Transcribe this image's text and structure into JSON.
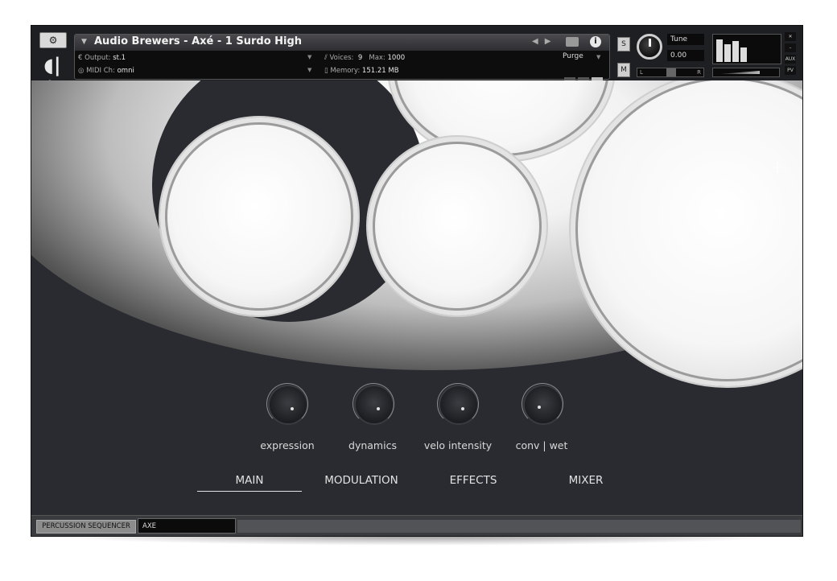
{
  "header": {
    "instrument_title": "Audio Brewers - Axé - 1 Surdo High",
    "output_label": "Output:",
    "output_value": "st.1",
    "voices_label": "Voices:",
    "voices_value": "9",
    "max_label": "Max:",
    "max_value": "1000",
    "midi_label": "MIDI Ch:",
    "midi_value": "omni",
    "memory_label": "Memory:",
    "memory_value": "151.21 MB",
    "purge_label": "Purge",
    "solo_label": "S",
    "mute_label": "M",
    "tune_label": "Tune",
    "tune_value": "0.00",
    "pan_left": "L",
    "pan_right": "R",
    "aux_label": "AUX",
    "pv_label": "PV"
  },
  "knobs": [
    {
      "label": "expression"
    },
    {
      "label": "dynamics"
    },
    {
      "label": "velo intensity"
    },
    {
      "label": "conv | wet"
    }
  ],
  "tabs": [
    "MAIN",
    "MODULATION",
    "EFFECTS",
    "MIXER"
  ],
  "bottom_tabs": [
    "PERCUSSION SEQUENCER",
    "AXE"
  ],
  "icons": [
    "wrench-icon",
    "logo-icon",
    "camera-icon",
    "info-icon",
    "crosshair-icon",
    "close-icon",
    "minimize-icon"
  ]
}
